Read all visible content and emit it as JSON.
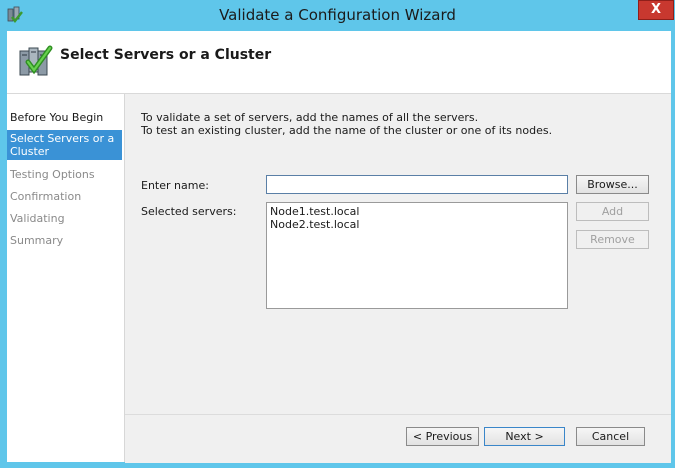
{
  "window": {
    "title": "Validate a Configuration Wizard",
    "close_label": "X"
  },
  "header": {
    "title": "Select Servers or a Cluster"
  },
  "nav": {
    "items": [
      {
        "label": "Before You Begin",
        "state": "normal"
      },
      {
        "label": "Select Servers or a Cluster",
        "state": "selected"
      },
      {
        "label": "Testing Options",
        "state": "disabled"
      },
      {
        "label": "Confirmation",
        "state": "disabled"
      },
      {
        "label": "Validating",
        "state": "disabled"
      },
      {
        "label": "Summary",
        "state": "disabled"
      }
    ]
  },
  "main": {
    "intro_line1": "To validate a set of servers, add the names of all the servers.",
    "intro_line2": "To test an existing cluster, add the name of the cluster or one of its nodes.",
    "enter_name_label": "Enter name:",
    "enter_name_value": "",
    "selected_servers_label": "Selected servers:",
    "selected_servers": [
      "Node1.test.local",
      "Node2.test.local"
    ],
    "browse_label": "Browse...",
    "add_label": "Add",
    "remove_label": "Remove"
  },
  "footer": {
    "previous_label": "< Previous",
    "next_label": "Next >",
    "cancel_label": "Cancel"
  },
  "colors": {
    "window_frame": "#5fc6ea",
    "selection": "#3a92d6",
    "close_button": "#c8382f"
  }
}
